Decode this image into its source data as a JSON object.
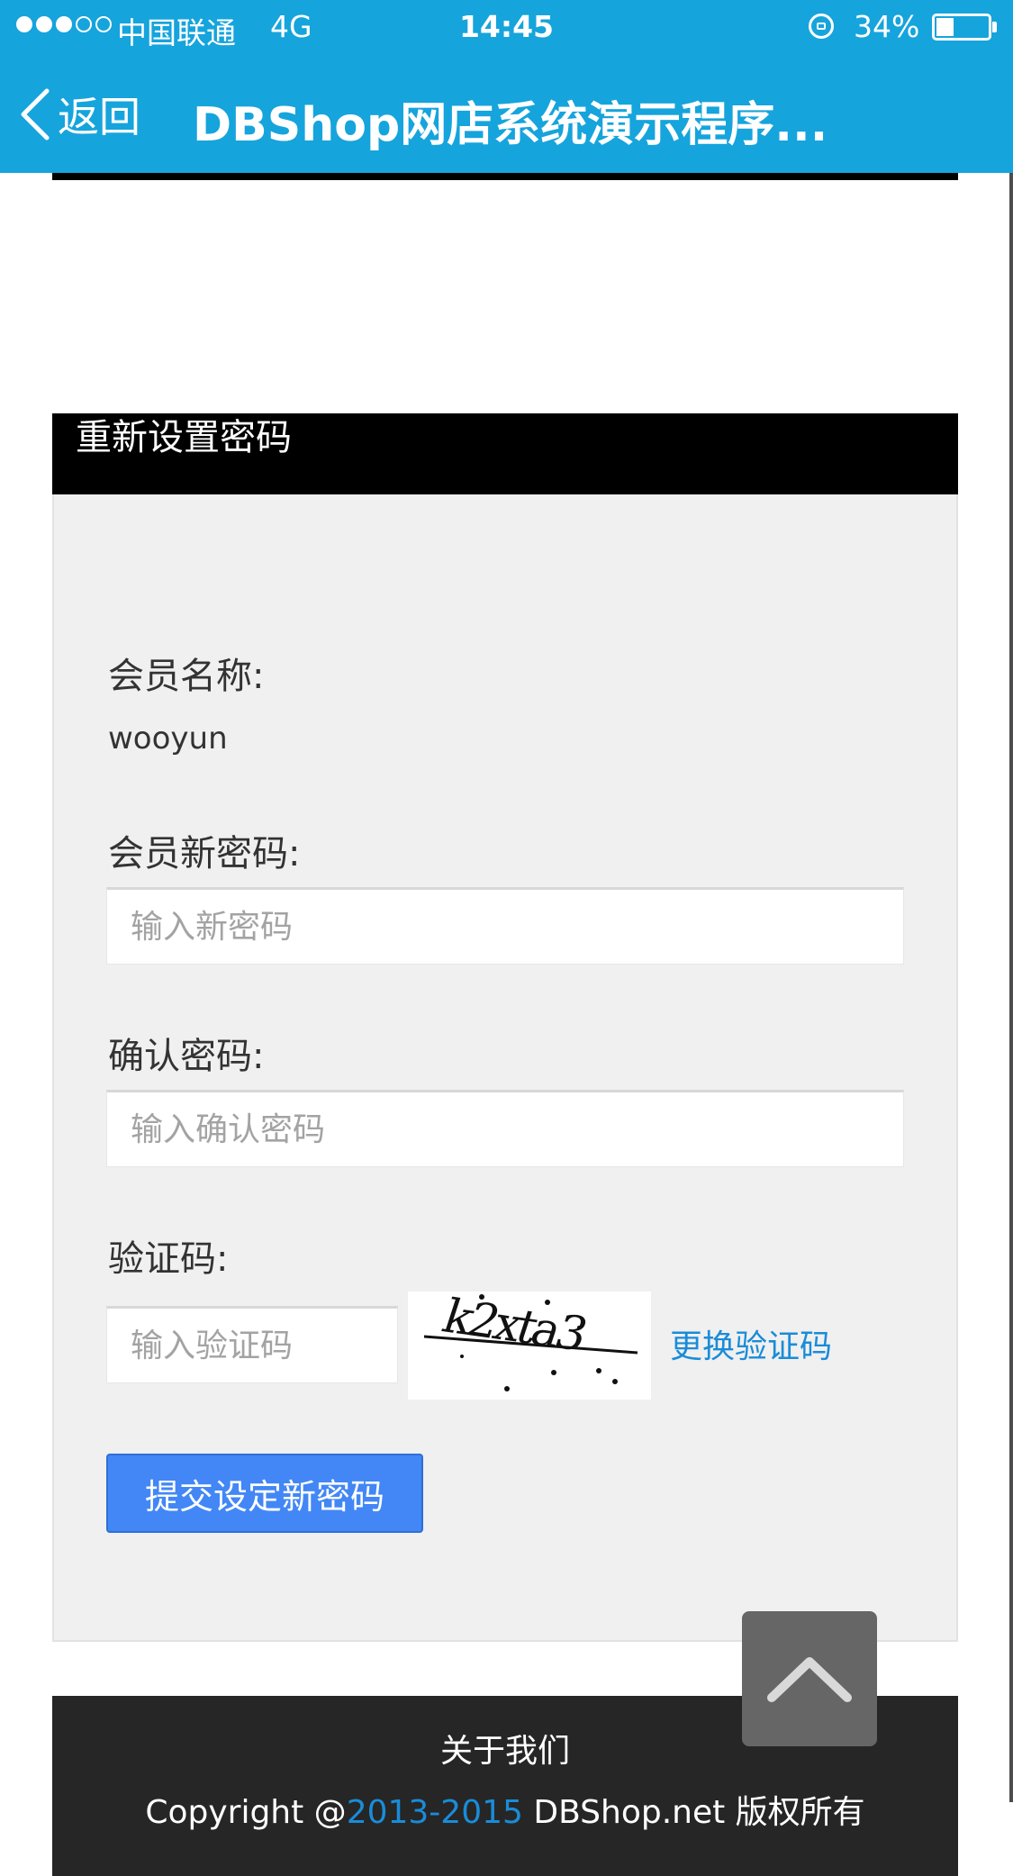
{
  "status_bar": {
    "carrier": "中国联通",
    "network": "4G",
    "time": "14:45",
    "battery_percent_label": "34%",
    "battery_level": 0.34,
    "signal_bars_filled": 3,
    "signal_bars_total": 5
  },
  "nav": {
    "back_label": "返回",
    "title": "DBShop网店系统演示程序..."
  },
  "panel": {
    "header_title": "重新设置密码",
    "member_name_label": "会员名称:",
    "member_name_value": "wooyun",
    "new_password_label": "会员新密码:",
    "new_password_placeholder": "输入新密码",
    "confirm_password_label": "确认密码:",
    "confirm_password_placeholder": "输入确认密码",
    "captcha_label": "验证码:",
    "captcha_placeholder": "输入验证码",
    "captcha_image_text": "k2xta3",
    "refresh_captcha_label": "更换验证码",
    "submit_label": "提交设定新密码"
  },
  "footer": {
    "about_label": "关于我们",
    "copyright_prefix": "Copyright @",
    "copyright_years": "2013-2015",
    "copyright_suffix": " DBShop.net 版权所有"
  },
  "colors": {
    "nav_background": "#16a4dc",
    "submit_button": "#4287f5",
    "link": "#1a8cd8",
    "footer_background": "#262626",
    "back_to_top": "#666666"
  },
  "icons": {
    "back": "chevron-left-icon",
    "back_to_top": "chevron-up-icon",
    "rotation_lock": "rotation-lock-icon",
    "battery": "battery-icon"
  }
}
